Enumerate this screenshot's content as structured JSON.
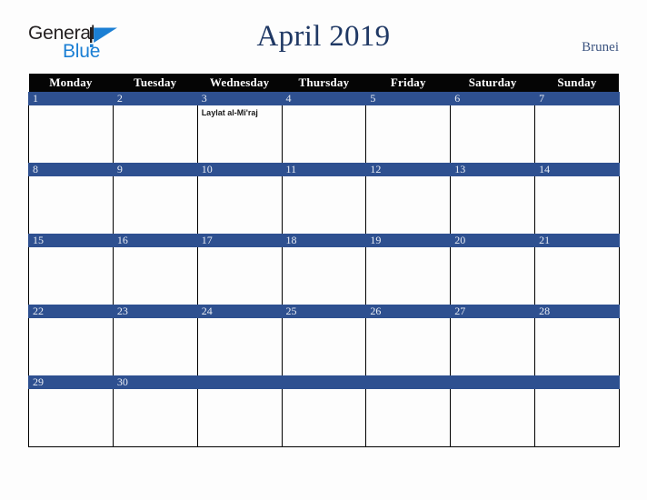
{
  "brand": {
    "name_part1": "General",
    "name_part2": "Blue",
    "mark": "triangle-logo-icon"
  },
  "header": {
    "title": "April 2019",
    "country": "Brunei"
  },
  "calendar": {
    "month": "April",
    "year": "2019",
    "weekday_headers": [
      "Monday",
      "Tuesday",
      "Wednesday",
      "Thursday",
      "Friday",
      "Saturday",
      "Sunday"
    ],
    "colors": {
      "date_band": "#2e5090",
      "weekday_header_bg": "#050505",
      "weekday_header_text": "#ffffff",
      "title_text": "#1f3864",
      "country_text": "#3c5480",
      "brand_blue": "#1b7fd4",
      "cell_bg": "#fdfdfd",
      "grid_line": "#000000"
    },
    "weeks": [
      {
        "days": [
          {
            "date": "1",
            "events": []
          },
          {
            "date": "2",
            "events": []
          },
          {
            "date": "3",
            "events": [
              "Laylat al-Mi'raj"
            ]
          },
          {
            "date": "4",
            "events": []
          },
          {
            "date": "5",
            "events": []
          },
          {
            "date": "6",
            "events": []
          },
          {
            "date": "7",
            "events": []
          }
        ]
      },
      {
        "days": [
          {
            "date": "8",
            "events": []
          },
          {
            "date": "9",
            "events": []
          },
          {
            "date": "10",
            "events": []
          },
          {
            "date": "11",
            "events": []
          },
          {
            "date": "12",
            "events": []
          },
          {
            "date": "13",
            "events": []
          },
          {
            "date": "14",
            "events": []
          }
        ]
      },
      {
        "days": [
          {
            "date": "15",
            "events": []
          },
          {
            "date": "16",
            "events": []
          },
          {
            "date": "17",
            "events": []
          },
          {
            "date": "18",
            "events": []
          },
          {
            "date": "19",
            "events": []
          },
          {
            "date": "20",
            "events": []
          },
          {
            "date": "21",
            "events": []
          }
        ]
      },
      {
        "days": [
          {
            "date": "22",
            "events": []
          },
          {
            "date": "23",
            "events": []
          },
          {
            "date": "24",
            "events": []
          },
          {
            "date": "25",
            "events": []
          },
          {
            "date": "26",
            "events": []
          },
          {
            "date": "27",
            "events": []
          },
          {
            "date": "28",
            "events": []
          }
        ]
      },
      {
        "days": [
          {
            "date": "29",
            "events": []
          },
          {
            "date": "30",
            "events": []
          },
          {
            "date": "",
            "events": []
          },
          {
            "date": "",
            "events": []
          },
          {
            "date": "",
            "events": []
          },
          {
            "date": "",
            "events": []
          },
          {
            "date": "",
            "events": []
          }
        ]
      }
    ]
  }
}
